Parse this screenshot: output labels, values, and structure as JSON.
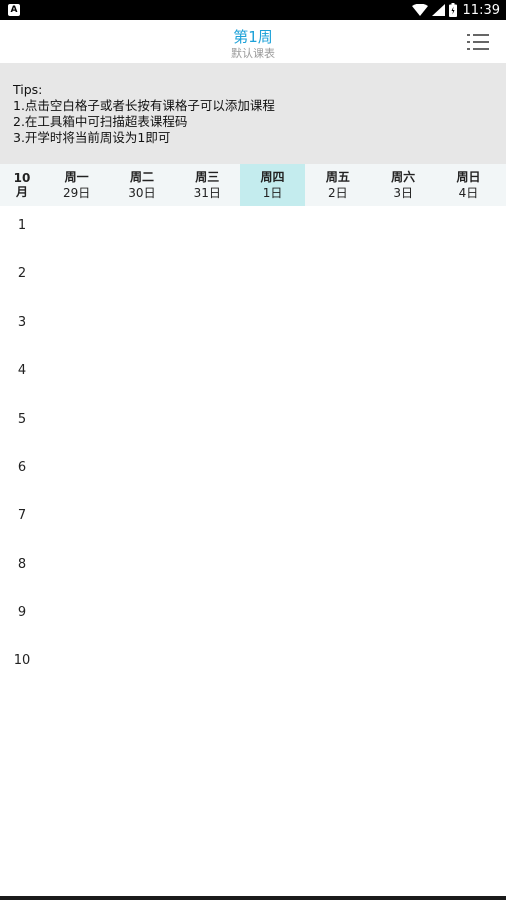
{
  "status_bar": {
    "notification_letter": "A",
    "time": "11:39",
    "icons": [
      "wifi-icon",
      "signal-icon",
      "battery-icon"
    ]
  },
  "header": {
    "title": "第1周",
    "subtitle": "默认课表",
    "menu_icon": "list-menu-icon",
    "accent_color": "#1da1d8"
  },
  "tips": {
    "heading": "Tips:",
    "lines": [
      "1.点击空白格子或者长按有课格子可以添加课程",
      "2.在工具箱中可扫描超表课程码",
      "3.开学时将当前周设为1即可"
    ]
  },
  "week": {
    "month_number": "10",
    "month_unit": "月",
    "days": [
      {
        "name": "周一",
        "date": "29日",
        "today": false
      },
      {
        "name": "周二",
        "date": "30日",
        "today": false
      },
      {
        "name": "周三",
        "date": "31日",
        "today": false
      },
      {
        "name": "周四",
        "date": "1日",
        "today": true
      },
      {
        "name": "周五",
        "date": "2日",
        "today": false
      },
      {
        "name": "周六",
        "date": "3日",
        "today": false
      },
      {
        "name": "周日",
        "date": "4日",
        "today": false
      }
    ],
    "today_color": "#c4ecee"
  },
  "timetable": {
    "slots": [
      "1",
      "2",
      "3",
      "4",
      "5",
      "6",
      "7",
      "8",
      "9",
      "10"
    ]
  }
}
